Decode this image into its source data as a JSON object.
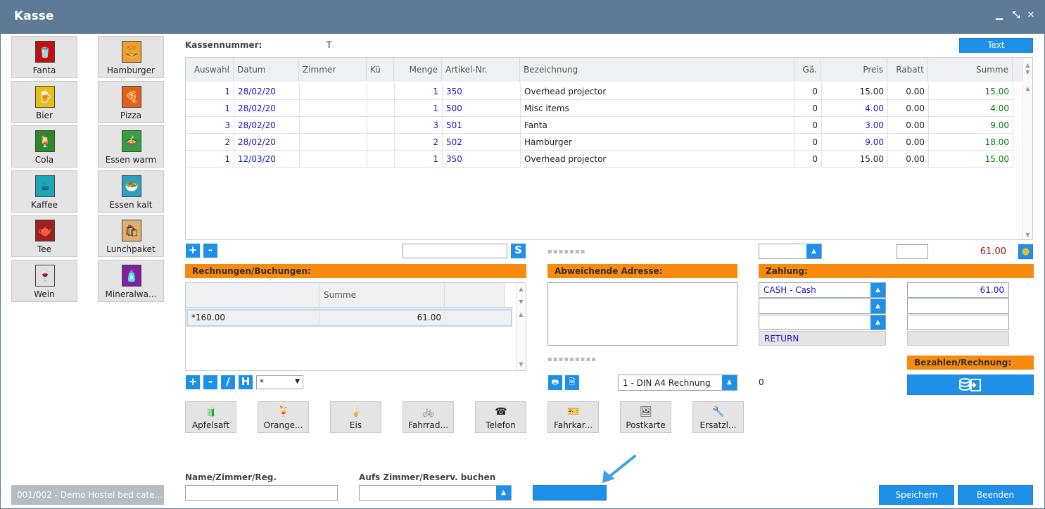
{
  "window": {
    "title": "Kasse",
    "minimize": "▁",
    "restore": "⤡",
    "close": "✕"
  },
  "products_left": [
    {
      "label": "Fanta",
      "icon": "fanta-icon",
      "glyph": "🥤",
      "color": "#c01010"
    },
    {
      "label": "Bier",
      "icon": "beer-icon",
      "glyph": "🍺",
      "color": "#e8c010"
    },
    {
      "label": "Cola",
      "icon": "cola-icon",
      "glyph": "🍹",
      "color": "#2a8a2a"
    },
    {
      "label": "Kaffee",
      "icon": "coffee-icon",
      "glyph": "☕",
      "color": "#1aa8b8"
    },
    {
      "label": "Tee",
      "icon": "tea-icon",
      "glyph": "🫖",
      "color": "#a02020"
    },
    {
      "label": "Wein",
      "icon": "wine-icon",
      "glyph": "🍷",
      "color": "#e0e0e0"
    }
  ],
  "products_right": [
    {
      "label": "Hamburger",
      "icon": "hamburger-icon",
      "glyph": "🍔",
      "color": "#f0a030"
    },
    {
      "label": "Pizza",
      "icon": "pizza-icon",
      "glyph": "🍕",
      "color": "#e06020"
    },
    {
      "label": "Essen warm",
      "icon": "hot-meal-icon",
      "glyph": "🍲",
      "color": "#30a040"
    },
    {
      "label": "Essen kalt",
      "icon": "cold-meal-icon",
      "glyph": "🥗",
      "color": "#30a0c0"
    },
    {
      "label": "Lunchpaket",
      "icon": "lunch-bag-icon",
      "glyph": "🛍",
      "color": "#e0b070"
    },
    {
      "label": "Mineralwa...",
      "icon": "water-bottle-icon",
      "glyph": "🧴",
      "color": "#8020a0"
    }
  ],
  "kassennummer": {
    "label": "Kassennummer:",
    "value": "T"
  },
  "text_button": "Text",
  "columns": [
    "Auswahl",
    "Datum",
    "Zimmer",
    "Kü",
    "Menge",
    "Artikel-Nr.",
    "Bezeichnung",
    "Gä.",
    "Preis",
    "Rabatt",
    "Summe"
  ],
  "rows": [
    {
      "auswahl": "1",
      "datum": "28/02/20",
      "zimmer": "",
      "ku": "",
      "menge": "1",
      "artikel": "350",
      "bez": "Overhead projector",
      "ga": "0",
      "preis": "15.00",
      "rabatt": "0.00",
      "summe": "15.00",
      "preis_blue": false
    },
    {
      "auswahl": "1",
      "datum": "28/02/20",
      "zimmer": "",
      "ku": "",
      "menge": "1",
      "artikel": "500",
      "bez": "Misc items",
      "ga": "0",
      "preis": "4.00",
      "rabatt": "0.00",
      "summe": "4.00",
      "preis_blue": true
    },
    {
      "auswahl": "3",
      "datum": "28/02/20",
      "zimmer": "",
      "ku": "",
      "menge": "3",
      "artikel": "501",
      "bez": "Fanta",
      "ga": "0",
      "preis": "3.00",
      "rabatt": "0.00",
      "summe": "9.00",
      "preis_blue": true
    },
    {
      "auswahl": "2",
      "datum": "28/02/20",
      "zimmer": "",
      "ku": "",
      "menge": "2",
      "artikel": "502",
      "bez": "Hamburger",
      "ga": "0",
      "preis": "9.00",
      "rabatt": "0.00",
      "summe": "18.00",
      "preis_blue": true
    },
    {
      "auswahl": "1",
      "datum": "12/03/20",
      "zimmer": "",
      "ku": "",
      "menge": "1",
      "artikel": "350",
      "bez": "Overhead projector",
      "ga": "0",
      "preis": "15.00",
      "rabatt": "0.00",
      "summe": "15.00",
      "preis_blue": false
    }
  ],
  "table_controls": {
    "add": "+",
    "remove": "-",
    "search_btn": "S",
    "search_value": "",
    "total": "61.00",
    "right_input": ""
  },
  "rechnungen": {
    "header": "Rechnungen/Buchungen:",
    "column_summe": "Summe",
    "row": {
      "name": "*160.00",
      "summe": "61.00"
    },
    "btn_add": "+",
    "btn_remove": "-",
    "btn_slash": "/",
    "btn_h": "H",
    "filter_value": "*"
  },
  "adresse": {
    "header": "Abweichende Adresse:",
    "value": ""
  },
  "zahlung": {
    "header": "Zahlung:",
    "method1": "CASH - Cash",
    "amount1": "61.00",
    "return_label": "RETURN",
    "bezahlen_header": "Bezahlen/Rechnung:"
  },
  "print": {
    "format": "1 - DIN A4 Rechnung",
    "count": "0"
  },
  "quick_items": [
    {
      "label": "Apfelsaft",
      "icon": "apple-juice-icon",
      "glyph": "🧃"
    },
    {
      "label": "Orange...",
      "icon": "orange-juice-icon",
      "glyph": "🍹"
    },
    {
      "label": "Eis",
      "icon": "ice-cream-icon",
      "glyph": "🍦"
    },
    {
      "label": "Fahrrad...",
      "icon": "bicycle-icon",
      "glyph": "🚲"
    },
    {
      "label": "Telefon",
      "icon": "telephone-icon",
      "glyph": "☎"
    },
    {
      "label": "Fahrkar...",
      "icon": "ticket-icon",
      "glyph": "🎫"
    },
    {
      "label": "Postkarte",
      "icon": "postcard-icon",
      "glyph": "🖼"
    },
    {
      "label": "Ersatzl...",
      "icon": "spare-part-icon",
      "glyph": "🔧"
    }
  ],
  "footer": {
    "hostel_label": "001/002 - Demo Hostel bed cate...",
    "name_label": "Name/Zimmer/Reg.",
    "name_value": "",
    "zimmer_label": "Aufs Zimmer/Reserv. buchen",
    "zimmer_value": "",
    "speichern": "Speichern",
    "beenden": "Beenden"
  }
}
